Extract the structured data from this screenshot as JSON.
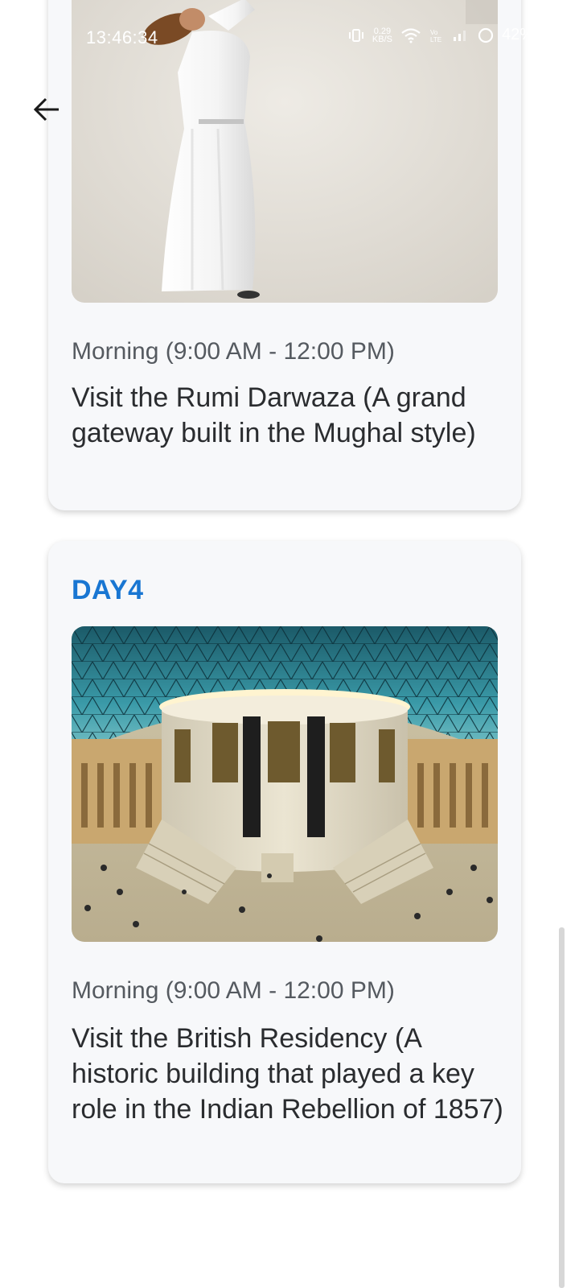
{
  "status_bar": {
    "time": "13:46:34",
    "net_speed_value": "0.29",
    "net_speed_unit": "KB/S",
    "battery": "42%"
  },
  "navigation": {
    "back_icon": "arrow-left-icon"
  },
  "days": [
    {
      "title": "",
      "image_description": "dancer-in-white",
      "time_label": "Morning (9:00 AM - 12:00 PM)",
      "activity": "Visit the Rumi Darwaza (A grand gateway built in the Mughal style)"
    },
    {
      "title": "DAY4",
      "image_description": "museum-great-court",
      "time_label": "Morning (9:00 AM - 12:00 PM)",
      "activity": "Visit the British Residency (A historic building that played a key role in the Indian Rebellion of 1857)"
    }
  ],
  "colors": {
    "accent": "#1976d2",
    "card_background": "#f7f8fa"
  }
}
